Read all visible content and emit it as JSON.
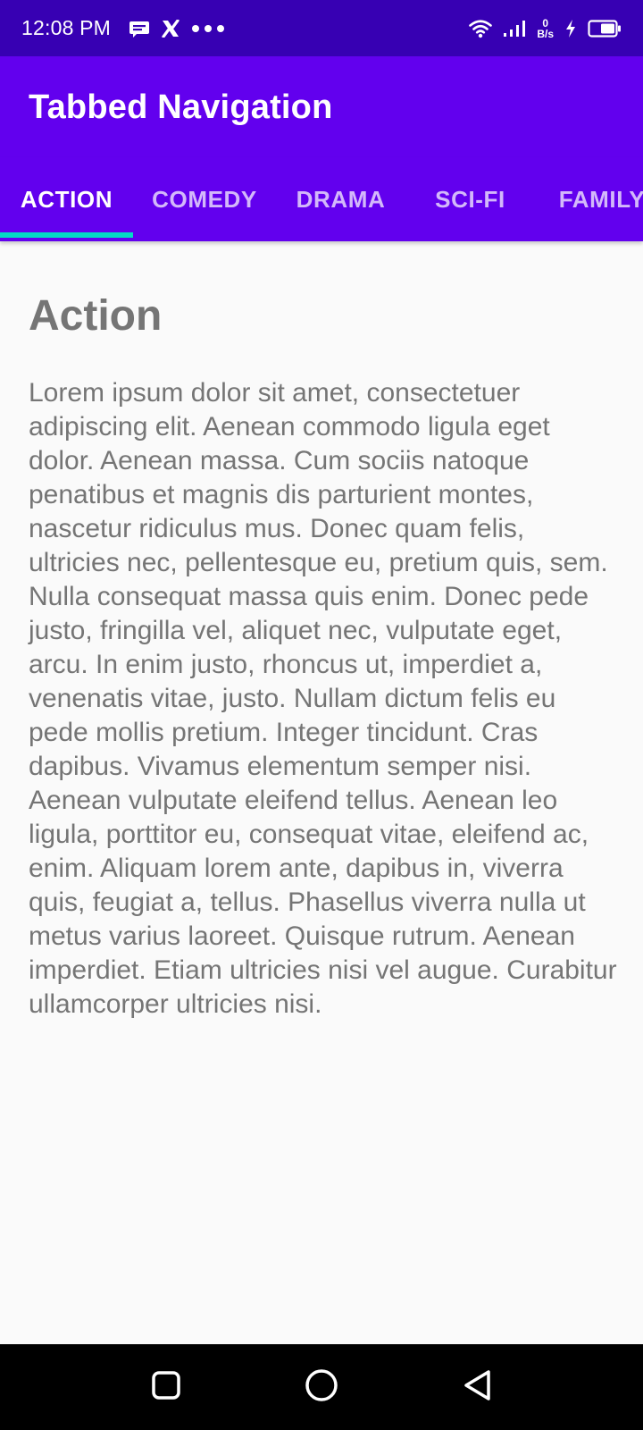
{
  "status_bar": {
    "time": "12:08 PM",
    "net_speed_value": "0",
    "net_speed_unit": "B/s"
  },
  "app_bar": {
    "title": "Tabbed Navigation"
  },
  "tabs": [
    {
      "label": "ACTION",
      "active": true
    },
    {
      "label": "COMEDY",
      "active": false
    },
    {
      "label": "DRAMA",
      "active": false
    },
    {
      "label": "SCI-FI",
      "active": false
    },
    {
      "label": "FAMILY",
      "active": false
    }
  ],
  "content": {
    "title": "Action",
    "body": "Lorem ipsum dolor sit amet, consectetuer adipiscing elit. Aenean commodo ligula eget dolor. Aenean massa. Cum sociis natoque penatibus et magnis dis parturient montes, nascetur ridiculus mus. Donec quam felis, ultricies nec, pellentesque eu, pretium quis, sem. Nulla consequat massa quis enim. Donec pede justo, fringilla vel, aliquet nec, vulputate eget, arcu. In enim justo, rhoncus ut, imperdiet a, venenatis vitae, justo. Nullam dictum felis eu pede mollis pretium. Integer tincidunt. Cras dapibus. Vivamus elementum semper nisi. Aenean vulputate eleifend tellus. Aenean leo ligula, porttitor eu, consequat vitae, eleifend ac, enim. Aliquam lorem ante, dapibus in, viverra quis, feugiat a, tellus. Phasellus viverra nulla ut metus varius laoreet. Quisque rutrum. Aenean imperdiet. Etiam ultricies nisi vel augue. Curabitur ullamcorper ultricies nisi."
  },
  "colors": {
    "status_bar": "#3700b3",
    "primary": "#6200ee",
    "indicator": "#03dac5",
    "text_secondary": "#757575",
    "background": "#fafafa"
  },
  "icons": {
    "status_left": [
      "message-icon",
      "x-icon",
      "more-dots-icon"
    ],
    "status_right": [
      "wifi-icon",
      "signal-icon",
      "charging-icon",
      "battery-icon"
    ],
    "nav": [
      "recents-square-icon",
      "home-circle-icon",
      "back-triangle-icon"
    ]
  }
}
